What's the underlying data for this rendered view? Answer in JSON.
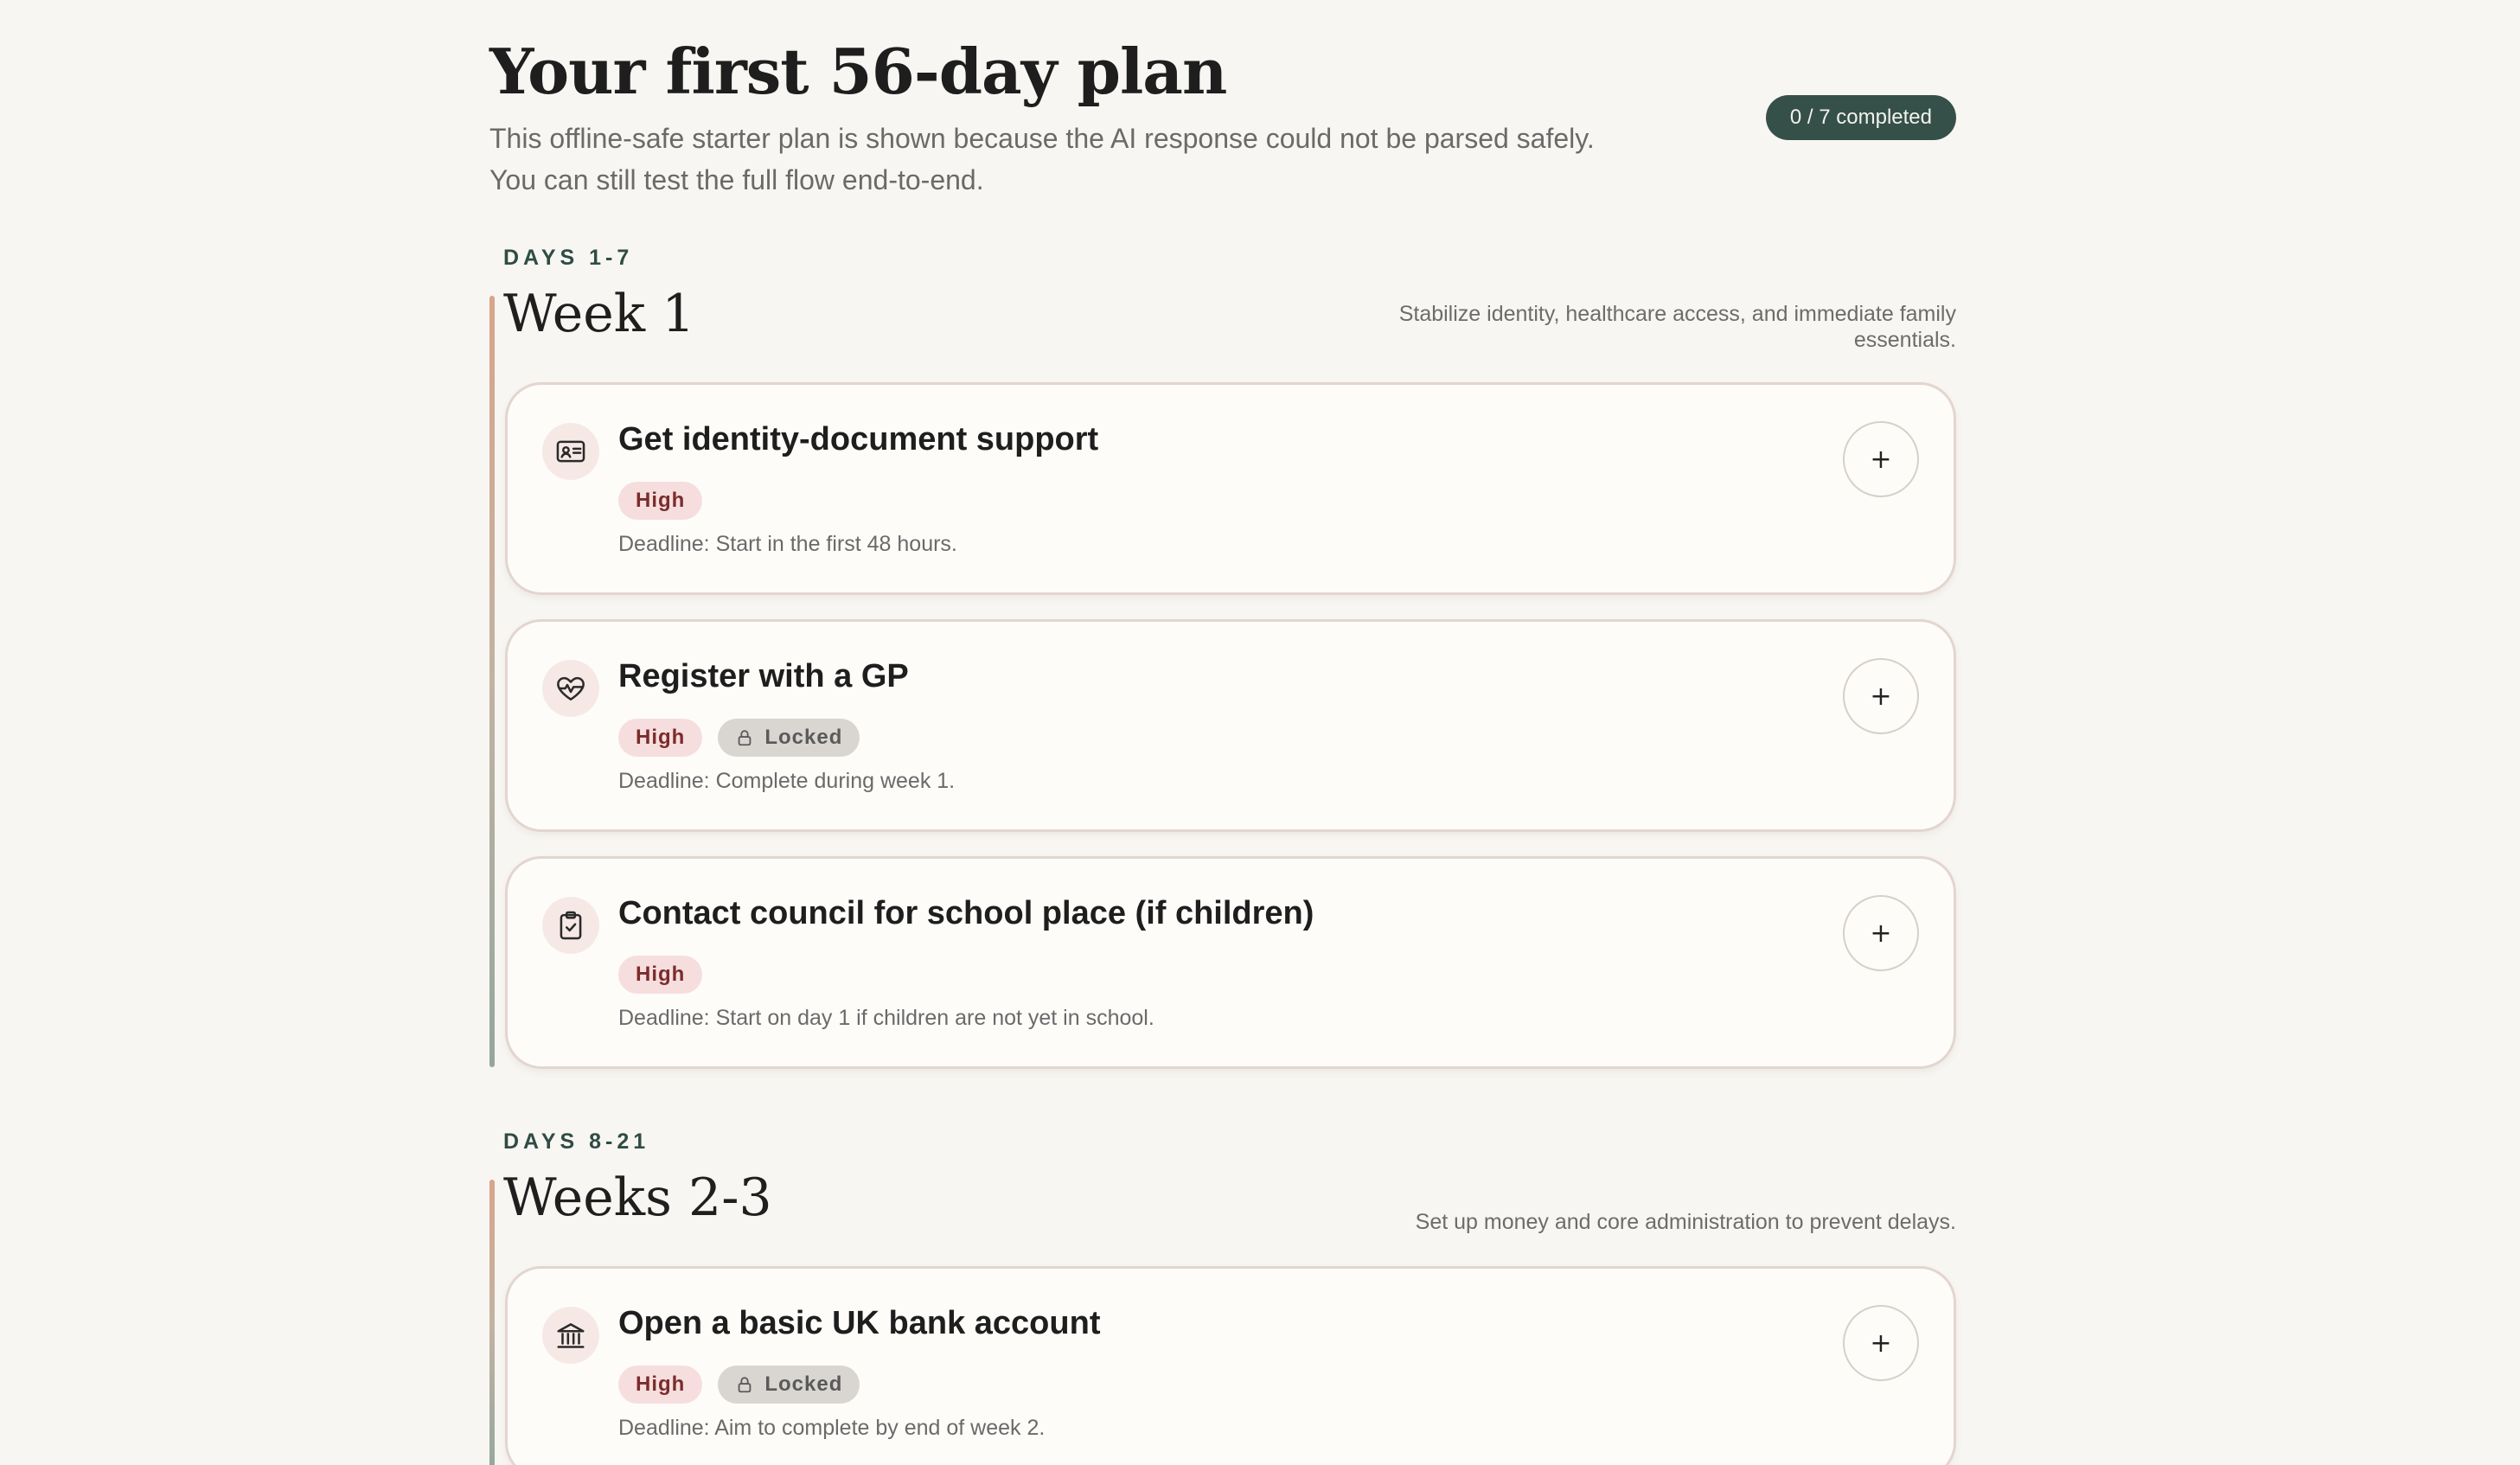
{
  "header": {
    "title": "Your first 56-day plan",
    "intro_line1": "This offline-safe starter plan is shown because the AI response could not be parsed safely.",
    "intro_line2": "You can still test the full flow end-to-end.",
    "progress": "0 / 7 completed"
  },
  "sections": [
    {
      "days": "DAYS 1-7",
      "title": "Week 1",
      "description": "Stabilize identity, healthcare access, and immediate family essentials.",
      "tasks": [
        {
          "icon": "id-card-icon",
          "title": "Get identity-document support",
          "priority": "High",
          "locked": false,
          "deadline": "Deadline: Start in the first 48 hours.",
          "add_label": "+"
        },
        {
          "icon": "heart-pulse-icon",
          "title": "Register with a GP",
          "priority": "High",
          "locked": true,
          "locked_label": "Locked",
          "deadline": "Deadline: Complete during week 1.",
          "add_label": "+"
        },
        {
          "icon": "clipboard-check-icon",
          "title": "Contact council for school place (if children)",
          "priority": "High",
          "locked": false,
          "deadline": "Deadline: Start on day 1 if children are not yet in school.",
          "add_label": "+"
        }
      ]
    },
    {
      "days": "DAYS 8-21",
      "title": "Weeks 2-3",
      "description": "Set up money and core administration to prevent delays.",
      "tasks": [
        {
          "icon": "bank-icon",
          "title": "Open a basic UK bank account",
          "priority": "High",
          "locked": true,
          "locked_label": "Locked",
          "deadline": "Deadline: Aim to complete by end of week 2.",
          "add_label": "+"
        }
      ]
    }
  ],
  "colors": {
    "background": "#f8f6f2",
    "accent_dark": "#355049",
    "high_tag_bg": "#f6dede",
    "high_tag_text": "#7b2c2c",
    "locked_tag_bg": "#d9d6d2"
  }
}
